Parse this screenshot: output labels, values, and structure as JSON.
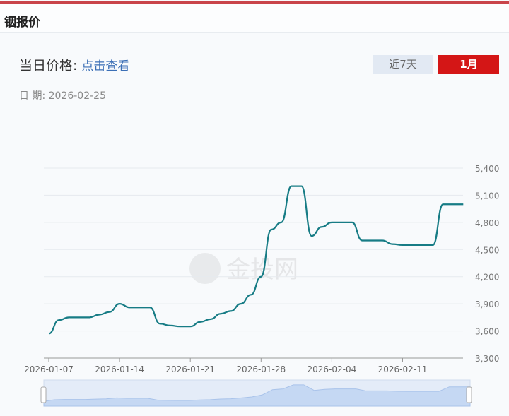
{
  "header": {
    "title": "铟报价"
  },
  "price": {
    "label": "当日价格:",
    "link": "点击查看"
  },
  "range_buttons": [
    {
      "label": "近7天",
      "active": false
    },
    {
      "label": "1月",
      "active": true
    }
  ],
  "date": {
    "label": "日 期:",
    "value": "2026-02-25"
  },
  "watermark": "金投网",
  "colors": {
    "line": "#177c85",
    "active": "#d41616",
    "grid": "#e6e9ee"
  },
  "chart_data": {
    "type": "line",
    "title": "",
    "xlabel": "",
    "ylabel": "",
    "ylim": [
      3300,
      5400
    ],
    "yticks": [
      "3,300",
      "3,600",
      "3,900",
      "4,200",
      "4,500",
      "4,800",
      "5,100",
      "5,400"
    ],
    "ytick_values": [
      3300,
      3600,
      3900,
      4200,
      4500,
      4800,
      5100,
      5400
    ],
    "xticks": [
      "2026-01-07",
      "2026-01-14",
      "2026-01-21",
      "2026-01-28",
      "2026-02-04",
      "2026-02-11"
    ],
    "x": [
      "01-07",
      "01-08",
      "01-09",
      "01-10",
      "01-11",
      "01-12",
      "01-13",
      "01-14",
      "01-15",
      "01-16",
      "01-17",
      "01-18",
      "01-19",
      "01-20",
      "01-21",
      "01-22",
      "01-23",
      "01-24",
      "01-25",
      "01-26",
      "01-27",
      "01-28",
      "01-29",
      "01-30",
      "01-31",
      "02-01",
      "02-02",
      "02-03",
      "02-04",
      "02-05",
      "02-06",
      "02-07",
      "02-08",
      "02-09",
      "02-10",
      "02-11",
      "02-12",
      "02-13",
      "02-14",
      "02-15",
      "02-16",
      "02-17"
    ],
    "values": [
      3570,
      3720,
      3750,
      3750,
      3750,
      3780,
      3810,
      3900,
      3860,
      3860,
      3860,
      3680,
      3660,
      3650,
      3650,
      3700,
      3730,
      3790,
      3820,
      3900,
      4000,
      4200,
      4720,
      4800,
      5200,
      5200,
      4650,
      4750,
      4800,
      4800,
      4800,
      4600,
      4600,
      4600,
      4560,
      4550,
      4550,
      4550,
      4550,
      5000,
      5000,
      5000
    ],
    "grid": true,
    "legend": "none"
  }
}
